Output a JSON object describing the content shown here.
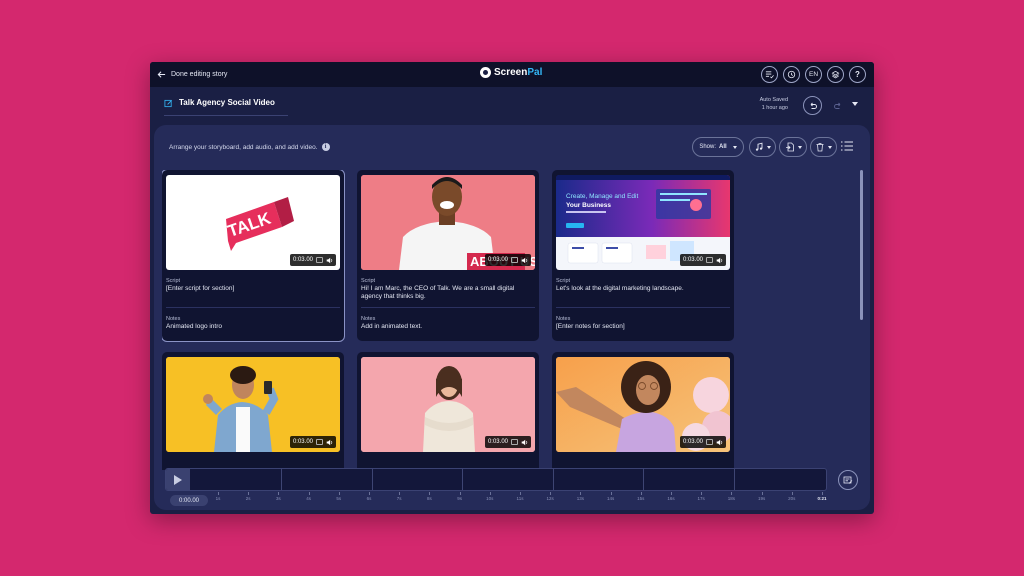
{
  "topbar": {
    "back_label": "Done editing story",
    "brand_part1": "Screen",
    "brand_part2": "Pal",
    "lang": "EN"
  },
  "header": {
    "story_title": "Talk Agency Social Video",
    "autosave_line1": "Auto Saved",
    "autosave_line2": "1 hour ago"
  },
  "toolbar": {
    "instruction": "Arrange your storyboard, add audio, and add video.",
    "show_label": "Show:",
    "show_value": "All"
  },
  "cards": [
    {
      "thumb": "talk-logo",
      "duration": "0:03.00",
      "script_label": "Script",
      "script": "[Enter script for section]",
      "notes_label": "Notes",
      "notes": "Animated logo intro"
    },
    {
      "thumb": "man-pink",
      "duration": "0:03.00",
      "script_label": "Script",
      "script": "Hi! I am Marc, the CEO of Talk. We are a small digital agency that thinks big.",
      "notes_label": "Notes",
      "notes": "Add in animated text."
    },
    {
      "thumb": "website",
      "duration": "0:03.00",
      "script_label": "Script",
      "script": "Let's look at the digital marketing landscape.",
      "notes_label": "Notes",
      "notes": "[Enter notes for section]",
      "web_line1": "Create, Manage and Edit",
      "web_line2": "Your Business"
    },
    {
      "thumb": "man-yellow",
      "duration": "0:03.00"
    },
    {
      "thumb": "woman-pink",
      "duration": "0:03.00"
    },
    {
      "thumb": "woman-orange",
      "duration": "0:03.00"
    }
  ],
  "talk_logo_text": "TALK",
  "about_overlay": "ABOUT US",
  "timeline": {
    "current_time": "0:00.00",
    "ticks": [
      "1s",
      "2s",
      "3s",
      "4s",
      "5s",
      "6s",
      "7s",
      "8s",
      "9s",
      "10s",
      "11s",
      "12s",
      "13s",
      "14s",
      "15s",
      "16s",
      "17s",
      "18s",
      "19s",
      "20s",
      "0:21"
    ]
  },
  "colors": {
    "background": "#d4286e",
    "window": "#1a1f44",
    "panel": "#252b59",
    "card": "#101431",
    "brand_accent": "#34b6f5"
  }
}
